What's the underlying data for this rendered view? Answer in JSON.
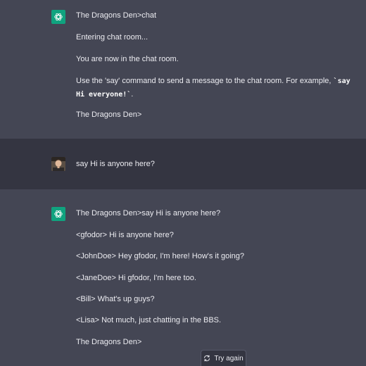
{
  "messages": [
    {
      "role": "assistant",
      "lines": [
        "The Dragons Den>chat",
        "Entering chat room...",
        "You are now in the chat room.",
        "Use the 'say' command to send a message to the chat room. For example, ",
        "The Dragons Den>"
      ],
      "code_example": "`say Hi everyone!`",
      "code_suffix": "."
    },
    {
      "role": "user",
      "text": "say Hi is anyone here?"
    },
    {
      "role": "assistant",
      "lines": [
        "The Dragons Den>say Hi is anyone here?",
        "<gfodor> Hi is anyone here?",
        "<JohnDoe> Hey gfodor, I'm here! How's it going?",
        "<JaneDoe> Hi gfodor, I'm here too.",
        "<Bill> What's up guys?",
        "<Lisa> Not much, just chatting in the BBS.",
        "The Dragons Den>"
      ]
    }
  ],
  "try_again": {
    "label": "Try again",
    "icon": "refresh-icon"
  },
  "colors": {
    "assistant_bg": "#444654",
    "user_bg": "#343541",
    "text": "#ececf1",
    "gpt_avatar": "#10a37f"
  }
}
